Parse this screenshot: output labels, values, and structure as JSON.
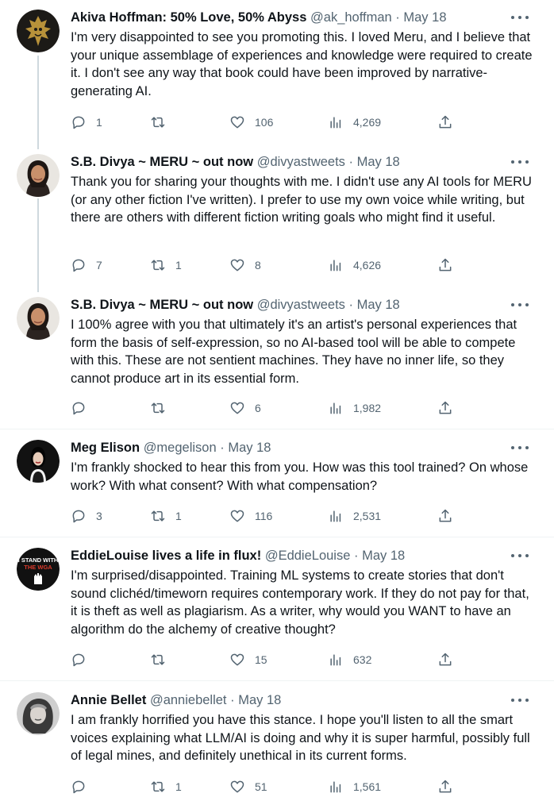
{
  "tweets": [
    {
      "name": "Akiva Hoffman: 50% Love, 50% Abyss",
      "handle": "@ak_hoffman",
      "dot": "·",
      "date": "May 18",
      "text": "I'm very disappointed to see you promoting this. I loved Meru, and I believe that your unique assemblage of experiences and knowledge were required to create it. I don't see any way that book could have been improved by narrative-generating AI.",
      "replies": "1",
      "retweets": "",
      "likes": "106",
      "views": "4,269",
      "avatar_icon": "golden-mask-avatar"
    },
    {
      "name": "S.B. Divya ~ MERU ~ out now",
      "handle": "@divyastweets",
      "dot": "·",
      "date": "May 18",
      "text": "Thank you for sharing your thoughts with me. I didn't use any AI tools for MERU (or any other fiction I've written). I prefer to use my own voice while writing, but there are others with different fiction writing goals who might find it useful.",
      "replies": "7",
      "retweets": "1",
      "likes": "8",
      "views": "4,626",
      "avatar_icon": "woman-portrait-avatar"
    },
    {
      "name": "S.B. Divya ~ MERU ~ out now",
      "handle": "@divyastweets",
      "dot": "·",
      "date": "May 18",
      "text": "I 100% agree with you that ultimately it's an artist's personal experiences that form the basis of self-expression, so no AI-based tool will be able to compete with this. These are not sentient machines. They have no inner life, so they cannot produce art in its essential form.",
      "replies": "",
      "retweets": "",
      "likes": "6",
      "views": "1,982",
      "avatar_icon": "woman-portrait-avatar"
    },
    {
      "name": "Meg Elison",
      "handle": "@megelison",
      "dot": "·",
      "date": "May 18",
      "text": "I'm frankly shocked to hear this from you. How was this tool trained? On whose work? With what consent? With what compensation?",
      "replies": "3",
      "retweets": "1",
      "likes": "116",
      "views": "2,531",
      "avatar_icon": "dark-portrait-avatar"
    },
    {
      "name": "EddieLouise lives a life in flux!",
      "handle": "@EddieLouise",
      "dot": "·",
      "date": "May 18",
      "text": "I'm surprised/disappointed. Training ML systems to create stories that don't sound clichéd/timeworn requires contemporary work. If they do not pay for that, it is theft as well as plagiarism. As a writer, why would you WANT to have an algorithm do the alchemy of creative thought?",
      "replies": "",
      "retweets": "",
      "likes": "15",
      "views": "632",
      "avatar_icon": "stand-with-wga-avatar",
      "avatar_text": [
        "I STAND WITH",
        "THE WGA"
      ]
    },
    {
      "name": "Annie Bellet",
      "handle": "@anniebellet",
      "dot": "·",
      "date": "May 18",
      "text": "I am frankly horrified you have this stance. I hope you'll listen to all the smart voices explaining what LLM/AI is doing and why it is super harmful, possibly full of legal mines, and definitely unethical in its current forms.",
      "replies": "",
      "retweets": "1",
      "likes": "51",
      "views": "1,561",
      "avatar_icon": "woman-grayscale-avatar"
    }
  ],
  "colors": {
    "text": "#0f1419",
    "secondary": "#536471",
    "thread_line": "#cfd9de",
    "divider": "#eff3f4"
  }
}
